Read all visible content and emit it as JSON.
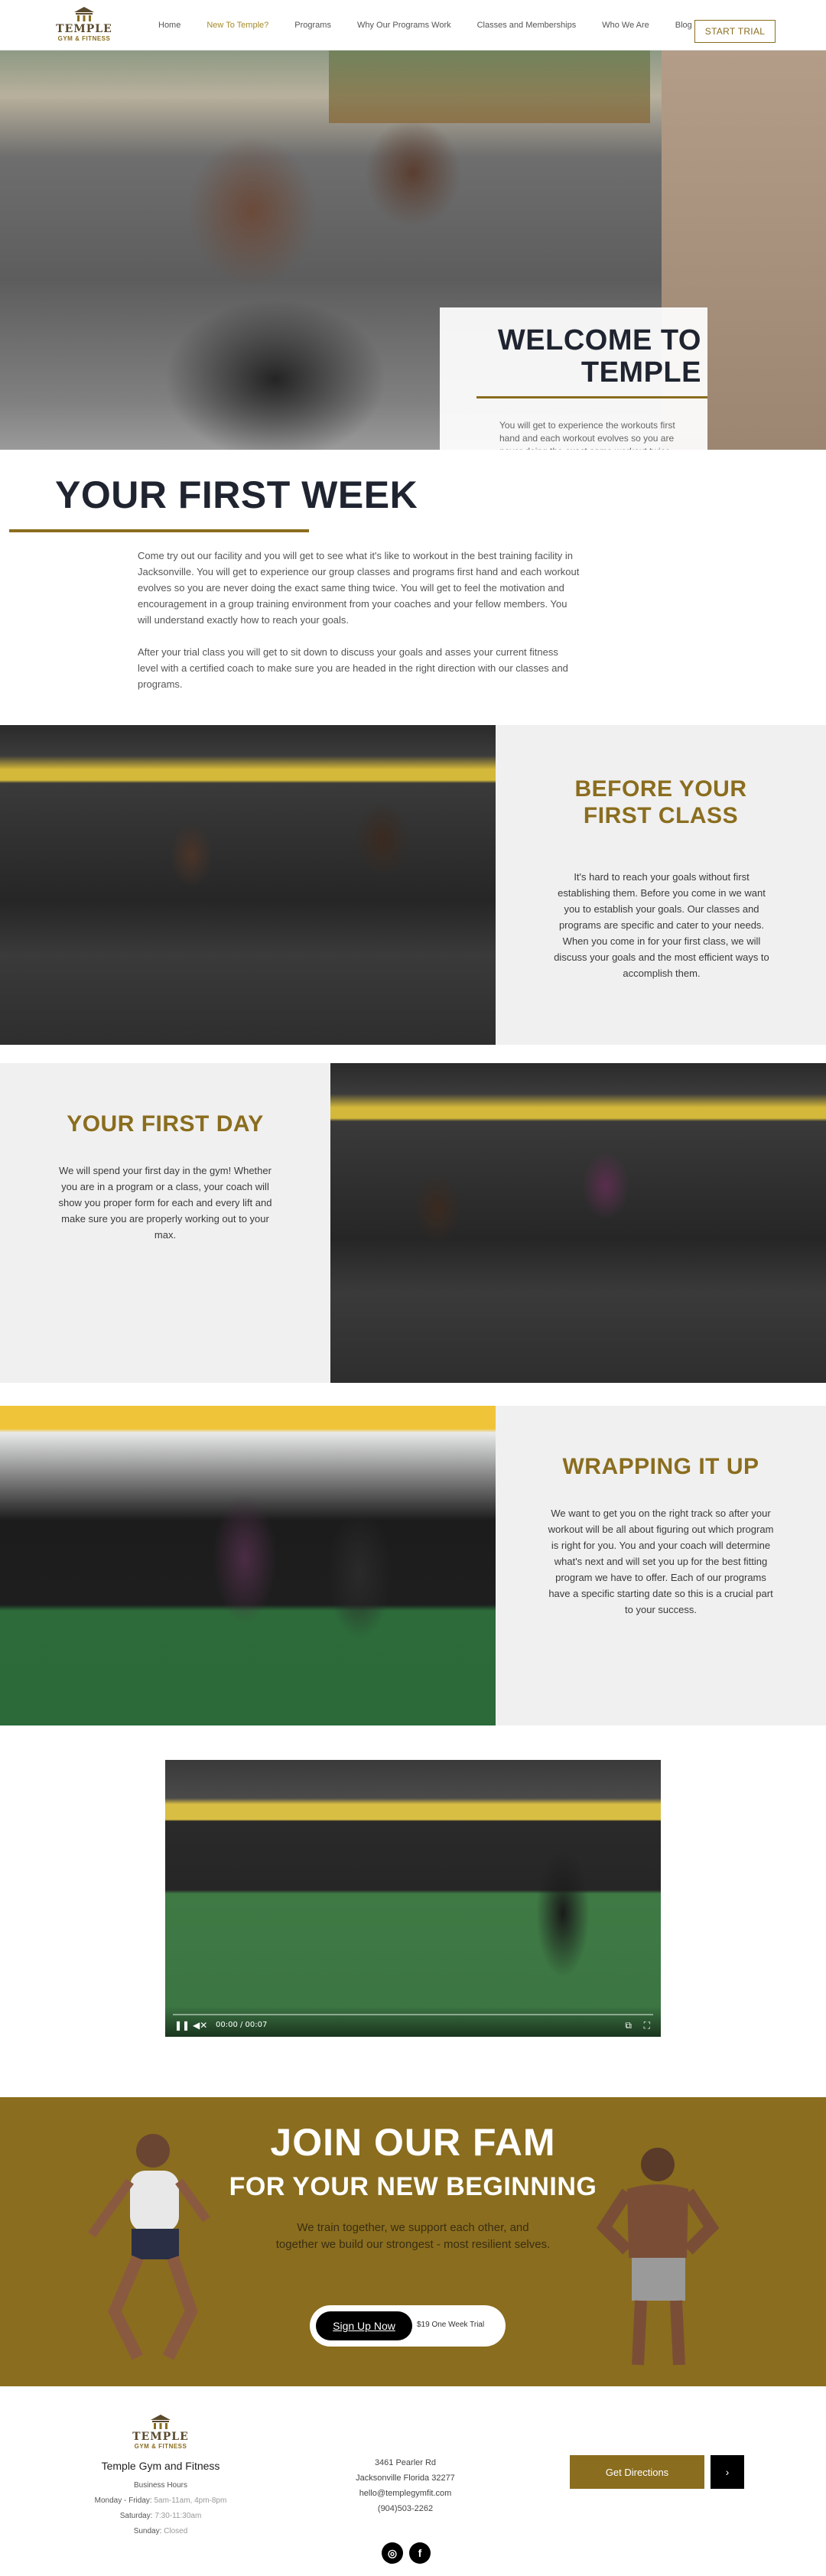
{
  "header": {
    "logo_name": "TEMPLE",
    "logo_sub": "GYM & FITNESS",
    "nav": [
      {
        "label": "Home",
        "active": false
      },
      {
        "label": "New To Temple?",
        "active": true
      },
      {
        "label": "Programs",
        "active": false
      },
      {
        "label": "Why Our Programs Work",
        "active": false
      },
      {
        "label": "Classes and Memberships",
        "active": false
      },
      {
        "label": "Who We Are",
        "active": false
      },
      {
        "label": "Blog",
        "active": false
      }
    ],
    "trial_button": "START TRIAL"
  },
  "hero": {
    "title_line1": "WELCOME TO",
    "title_line2": "TEMPLE",
    "text": "You will get to experience the workouts first hand and each workout evolves so you are never doing the exact same workout twice."
  },
  "first_week": {
    "title": "YOUR FIRST WEEK",
    "paragraph1": "Come try out our facility and you will get to see what it's like to workout in the best training facility in Jacksonville. You will get to experience our group classes and programs first hand and each workout evolves so you are never doing the exact same thing twice. You will get to feel the motivation and encouragement in a group training environment from your coaches and your fellow members. You will understand exactly how to reach your goals.",
    "paragraph2": "After your trial class you will get to sit down to discuss your goals and asses your current fitness level with a certified coach to make sure you are headed in the right direction with our classes and programs."
  },
  "before_first_class": {
    "title_line1": "BEFORE YOUR",
    "title_line2": "FIRST CLASS",
    "text": "It's hard to reach your goals without first establishing them. Before you come in we want you to establish your goals. Our classes and programs are specific and cater to your needs. When you come in for your first class, we will discuss your goals and the most efficient ways to accomplish them."
  },
  "first_day": {
    "title": "YOUR FIRST DAY",
    "text": "We will spend your first day in the gym! Whether you are in a program or a class, your coach will show you proper form for each and every lift and make sure you are properly working out to your max."
  },
  "wrapping_up": {
    "title": "WRAPPING IT UP",
    "text": "We want to get you on the right track so after your workout will be all about figuring out which program is right for you. You and your coach will determine what's next and will set you up for the best fitting program we have to offer. Each of our programs have a specific starting date so this is a crucial part to your success."
  },
  "video": {
    "time": "00:00 / 00:07",
    "play_icon": "pause-icon",
    "progress": 0
  },
  "join": {
    "title": "JOIN OUR FAM",
    "subtitle": "FOR YOUR NEW BEGINNING",
    "text": "We train together, we support each other, and together we build our strongest - most resilient selves.",
    "signup_button": "Sign Up Now",
    "signup_note": "$19 One Week Trial"
  },
  "footer": {
    "brand": "Temple Gym and Fitness",
    "hours_label": "Business Hours",
    "weekday_label": "Monday - Friday:",
    "weekday_hours": "5am-11am, 4pm-8pm",
    "saturday_label": "Saturday:",
    "saturday_hours": "7:30-11:30am",
    "sunday_label": "Sunday:",
    "sunday_hours": "Closed",
    "address1": "3461 Pearler Rd",
    "address2": "Jacksonville Florida 32277",
    "email": "hello@templegymfit.com",
    "phone": "(904)503-2262",
    "directions_button": "Get Directions",
    "directions_arrow": "›",
    "instagram_icon": "instagram-icon",
    "facebook_icon": "facebook-icon"
  },
  "colors": {
    "accent": "#8a6d1e",
    "heading_dark": "#1f2430",
    "gray_panel": "#f0f0f0"
  }
}
